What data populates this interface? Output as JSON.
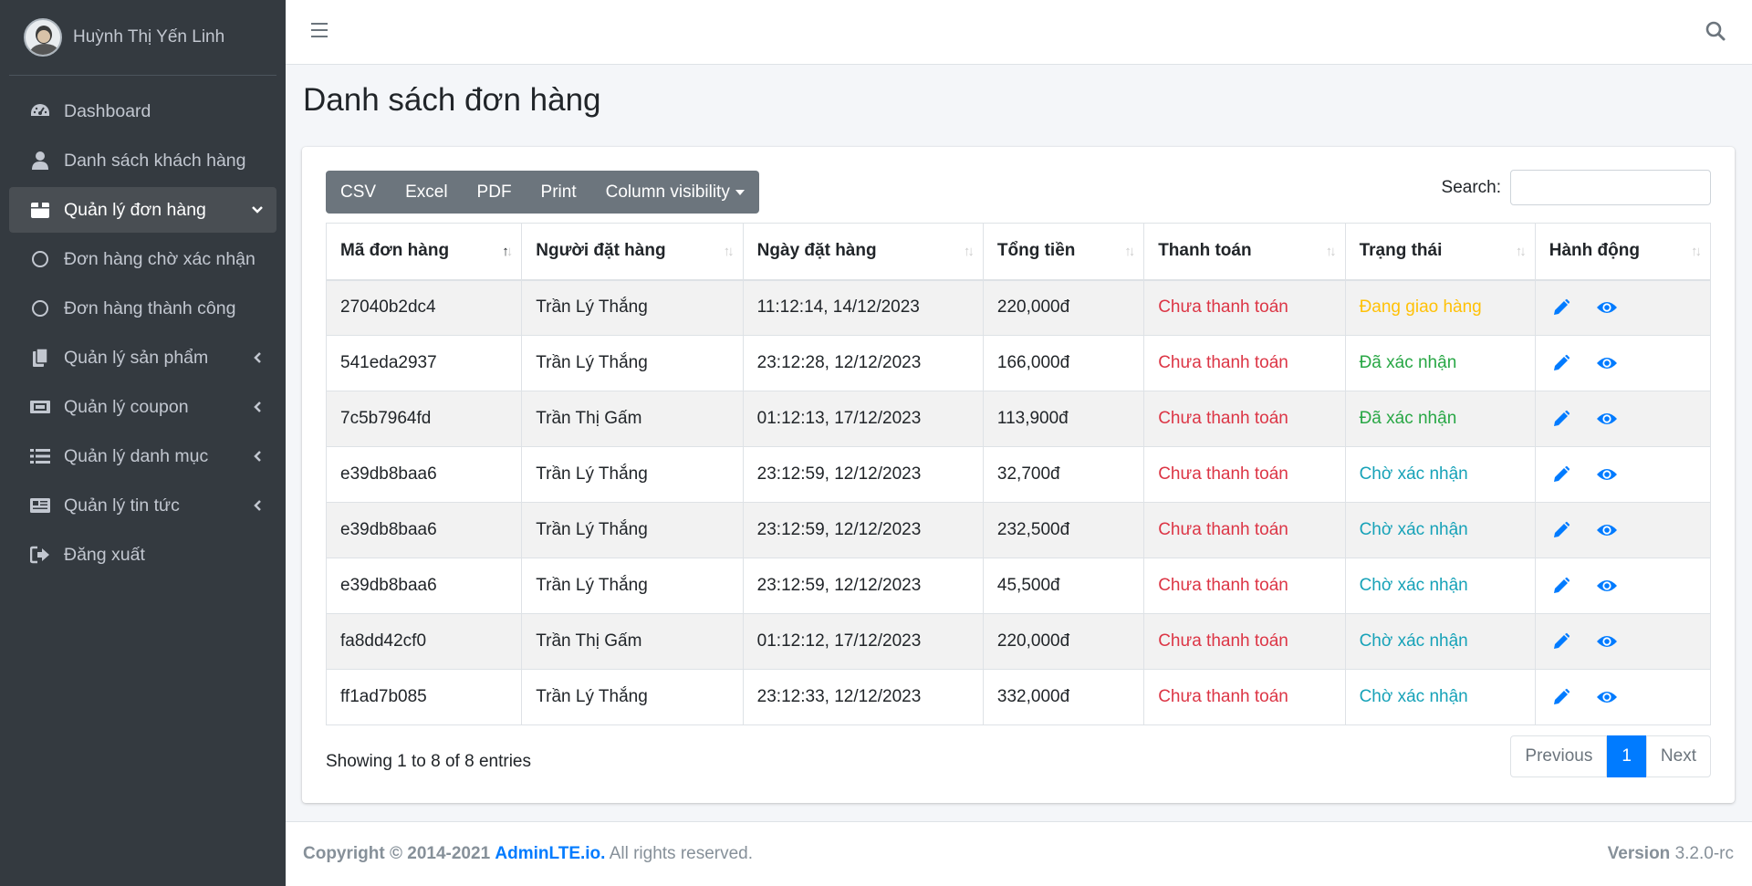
{
  "user": {
    "name": "Huỳnh Thị Yến Linh"
  },
  "sidebar": {
    "items": [
      {
        "label": "Dashboard",
        "icon": "dashboard-icon"
      },
      {
        "label": "Danh sách khách hàng",
        "icon": "user-icon"
      },
      {
        "label": "Quản lý đơn hàng",
        "icon": "box-icon",
        "expanded": true
      },
      {
        "label": "Đơn hàng chờ xác nhận",
        "icon": "circle-icon"
      },
      {
        "label": "Đơn hàng thành công",
        "icon": "circle-icon"
      },
      {
        "label": "Quản lý sản phẩm",
        "icon": "copy-icon"
      },
      {
        "label": "Quản lý coupon",
        "icon": "ticket-icon"
      },
      {
        "label": "Quản lý danh mục",
        "icon": "list-icon"
      },
      {
        "label": "Quản lý tin tức",
        "icon": "newspaper-icon"
      },
      {
        "label": "Đăng xuất",
        "icon": "sign-out-icon"
      }
    ]
  },
  "page": {
    "title": "Danh sách đơn hàng"
  },
  "toolbar": {
    "csv": "CSV",
    "excel": "Excel",
    "pdf": "PDF",
    "print": "Print",
    "column_visibility": "Column visibility"
  },
  "search": {
    "label": "Search:",
    "value": ""
  },
  "table": {
    "columns": [
      "Mã đơn hàng",
      "Người đặt hàng",
      "Ngày đặt hàng",
      "Tổng tiền",
      "Thanh toán",
      "Trạng thái",
      "Hành động"
    ],
    "rows": [
      {
        "id": "27040b2dc4",
        "customer": "Trần Lý Thắng",
        "date": "11:12:14, 14/12/2023",
        "total": "220,000đ",
        "payment": "Chưa thanh toán",
        "status": "Đang giao hàng"
      },
      {
        "id": "541eda2937",
        "customer": "Trần Lý Thắng",
        "date": "23:12:28, 12/12/2023",
        "total": "166,000đ",
        "payment": "Chưa thanh toán",
        "status": "Đã xác nhận"
      },
      {
        "id": "7c5b7964fd",
        "customer": "Trần Thị Gấm",
        "date": "01:12:13, 17/12/2023",
        "total": "113,900đ",
        "payment": "Chưa thanh toán",
        "status": "Đã xác nhận"
      },
      {
        "id": "e39db8baa6",
        "customer": "Trần Lý Thắng",
        "date": "23:12:59, 12/12/2023",
        "total": "32,700đ",
        "payment": "Chưa thanh toán",
        "status": "Chờ xác nhận"
      },
      {
        "id": "e39db8baa6",
        "customer": "Trần Lý Thắng",
        "date": "23:12:59, 12/12/2023",
        "total": "232,500đ",
        "payment": "Chưa thanh toán",
        "status": "Chờ xác nhận"
      },
      {
        "id": "e39db8baa6",
        "customer": "Trần Lý Thắng",
        "date": "23:12:59, 12/12/2023",
        "total": "45,500đ",
        "payment": "Chưa thanh toán",
        "status": "Chờ xác nhận"
      },
      {
        "id": "fa8dd42cf0",
        "customer": "Trần Thị Gấm",
        "date": "01:12:12, 17/12/2023",
        "total": "220,000đ",
        "payment": "Chưa thanh toán",
        "status": "Chờ xác nhận"
      },
      {
        "id": "ff1ad7b085",
        "customer": "Trần Lý Thắng",
        "date": "23:12:33, 12/12/2023",
        "total": "332,000đ",
        "payment": "Chưa thanh toán",
        "status": "Chờ xác nhận"
      }
    ]
  },
  "pagination": {
    "info": "Showing 1 to 8 of 8 entries",
    "previous": "Previous",
    "current": "1",
    "next": "Next"
  },
  "footer": {
    "copyright": "Copyright © 2014-2021",
    "brand": "AdminLTE.io.",
    "rights": "All rights reserved.",
    "version_label": "Version",
    "version": "3.2.0-rc"
  },
  "colors": {
    "sidebar_bg": "#343a40",
    "primary": "#007bff",
    "danger": "#dc3545",
    "warning": "#ffc107",
    "success": "#28a745",
    "info": "#17a2b8"
  }
}
